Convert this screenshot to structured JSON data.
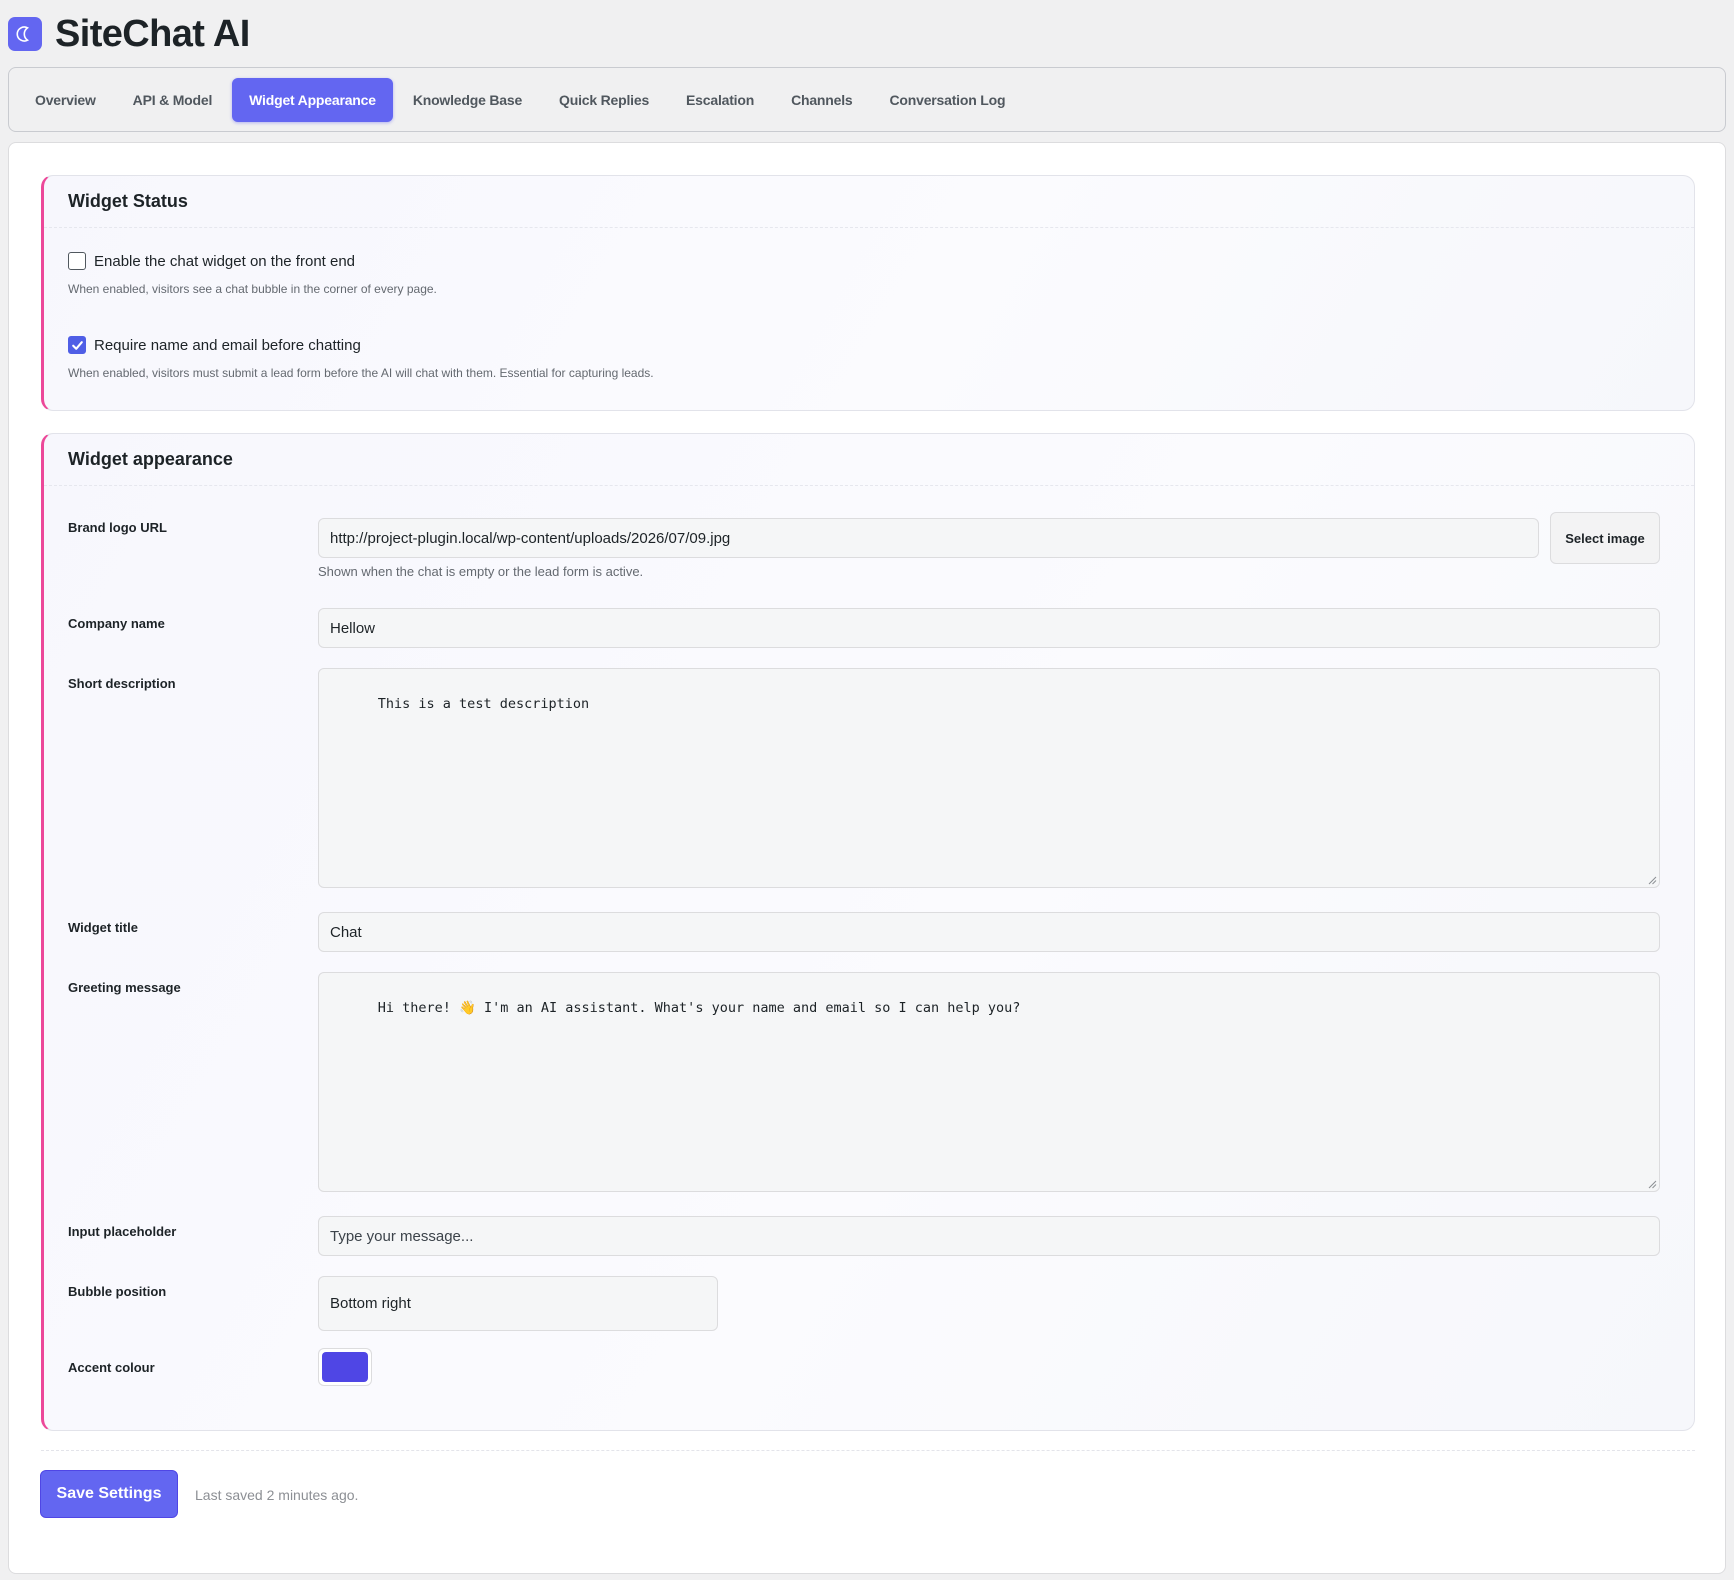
{
  "app": {
    "title": "SiteChat AI",
    "brand_color": "#6366f1"
  },
  "tabs": [
    {
      "label": "Overview",
      "active": false
    },
    {
      "label": "API & Model",
      "active": false
    },
    {
      "label": "Widget Appearance",
      "active": true
    },
    {
      "label": "Knowledge Base",
      "active": false
    },
    {
      "label": "Quick Replies",
      "active": false
    },
    {
      "label": "Escalation",
      "active": false
    },
    {
      "label": "Channels",
      "active": false
    },
    {
      "label": "Conversation Log",
      "active": false
    }
  ],
  "widget_status": {
    "title": "Widget Status",
    "enable": {
      "label": "Enable the chat widget on the front end",
      "checked": false,
      "help": "When enabled, visitors see a chat bubble in the corner of every page."
    },
    "require_lead": {
      "label": "Require name and email before chatting",
      "checked": true,
      "help": "When enabled, visitors must submit a lead form before the AI will chat with them. Essential for capturing leads."
    }
  },
  "appearance": {
    "title": "Widget appearance",
    "brand_logo": {
      "label": "Brand logo URL",
      "value": "http://project-plugin.local/wp-content/uploads/2026/07/09.jpg",
      "button": "Select image",
      "help": "Shown when the chat is empty or the lead form is active."
    },
    "company_name": {
      "label": "Company name",
      "value": "Hellow"
    },
    "short_description": {
      "label": "Short description",
      "value": "This is a test description"
    },
    "widget_title": {
      "label": "Widget title",
      "value": "Chat"
    },
    "greeting": {
      "label": "Greeting message",
      "value": "Hi there! 👋 I'm an AI assistant. What's your name and email so I can help you?"
    },
    "input_placeholder": {
      "label": "Input placeholder",
      "placeholder": "Type your message..."
    },
    "bubble_position": {
      "label": "Bubble position",
      "value": "Bottom right"
    },
    "accent_colour": {
      "label": "Accent colour",
      "value": "#4f46e5"
    }
  },
  "footer": {
    "save_label": "Save Settings",
    "status": "Last saved 2 minutes ago."
  }
}
